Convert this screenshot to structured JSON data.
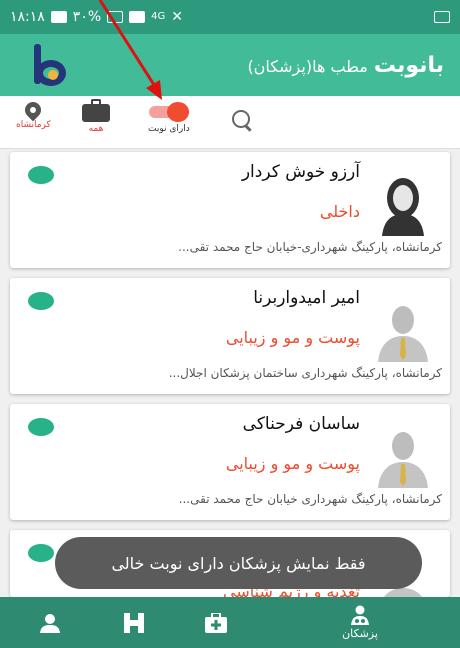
{
  "status_bar": {
    "time": "١٨:١٨",
    "battery": "٣٠%",
    "network": "4G"
  },
  "header": {
    "brand": "بانوبت",
    "subtitle": "مطب ها(پزشکان)"
  },
  "filters": {
    "location_label": "کرمانشاه",
    "all_label": "همه",
    "has_appointment_label": "دارای نوبت",
    "has_appointment_on": true
  },
  "doctors": [
    {
      "name": "آرزو خوش کردار",
      "specialty": "داخلی",
      "address": "کرمانشاه، پارکینگ شهرداری-خیابان حاج محمد تقی...",
      "gender": "female"
    },
    {
      "name": "امیر امیدواربرنا",
      "specialty": "پوست و مو و زیبایی",
      "address": "کرمانشاه، پارکینگ شهرداری ساختمان پزشکان اجلال...",
      "gender": "male"
    },
    {
      "name": "ساسان فرحناکی",
      "specialty": "پوست و مو و زیبایی",
      "address": "کرمانشاه، پارکینگ شهرداری خیابان حاج محمد تقی...",
      "gender": "male"
    },
    {
      "name": "",
      "specialty": "تغذیه و رژیم شناسی",
      "address": "",
      "gender": "male"
    }
  ],
  "toast": "فقط نمایش پزشکان دارای نوبت خالی",
  "bottom_nav": {
    "doctors_label": "پزشکان"
  },
  "colors": {
    "primary": "#41bb98",
    "dark_primary": "#2e8a70",
    "accent": "#ef4a2e",
    "status_dot": "#27b289"
  }
}
